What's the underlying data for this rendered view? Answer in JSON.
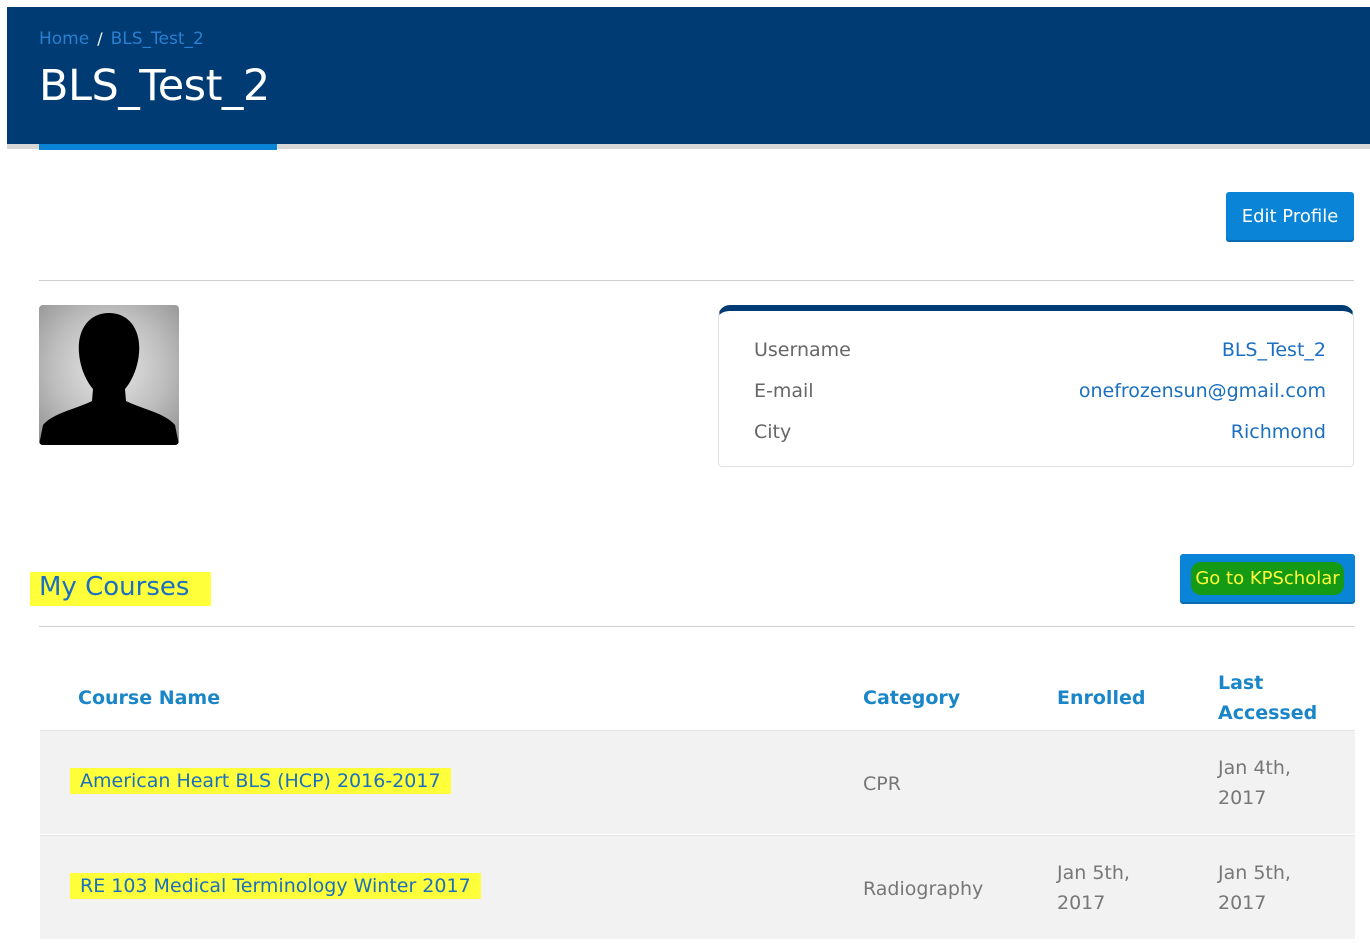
{
  "breadcrumb": {
    "home": "Home",
    "separator": "/",
    "current": "BLS_Test_2"
  },
  "page_title": "BLS_Test_2",
  "buttons": {
    "edit_profile": "Edit Profile",
    "go_to_kpscholar": "Go to KPScholar"
  },
  "profile": {
    "avatar_icon": "user-silhouette-icon",
    "fields": [
      {
        "label": "Username",
        "value": "BLS_Test_2"
      },
      {
        "label": "E-mail",
        "value": "onefrozensun@gmail.com"
      },
      {
        "label": "City",
        "value": "Richmond"
      }
    ]
  },
  "courses": {
    "title": "My Courses",
    "headers": {
      "name": "Course Name",
      "category": "Category",
      "enrolled": "Enrolled",
      "last_accessed_1": "Last",
      "last_accessed_2": "Accessed"
    },
    "rows": [
      {
        "name": "American Heart BLS (HCP) 2016-2017",
        "category": "CPR",
        "enrolled_1": "",
        "enrolled_2": "",
        "last_1": "Jan 4th,",
        "last_2": "2017"
      },
      {
        "name": "RE 103 Medical Terminology Winter 2017",
        "category": "Radiography",
        "enrolled_1": "Jan 5th,",
        "enrolled_2": "2017",
        "last_1": "Jan 5th,",
        "last_2": "2017"
      }
    ]
  },
  "colors": {
    "header_bg": "#003b73",
    "accent": "#0a84d6",
    "highlight": "#ffff3a"
  }
}
